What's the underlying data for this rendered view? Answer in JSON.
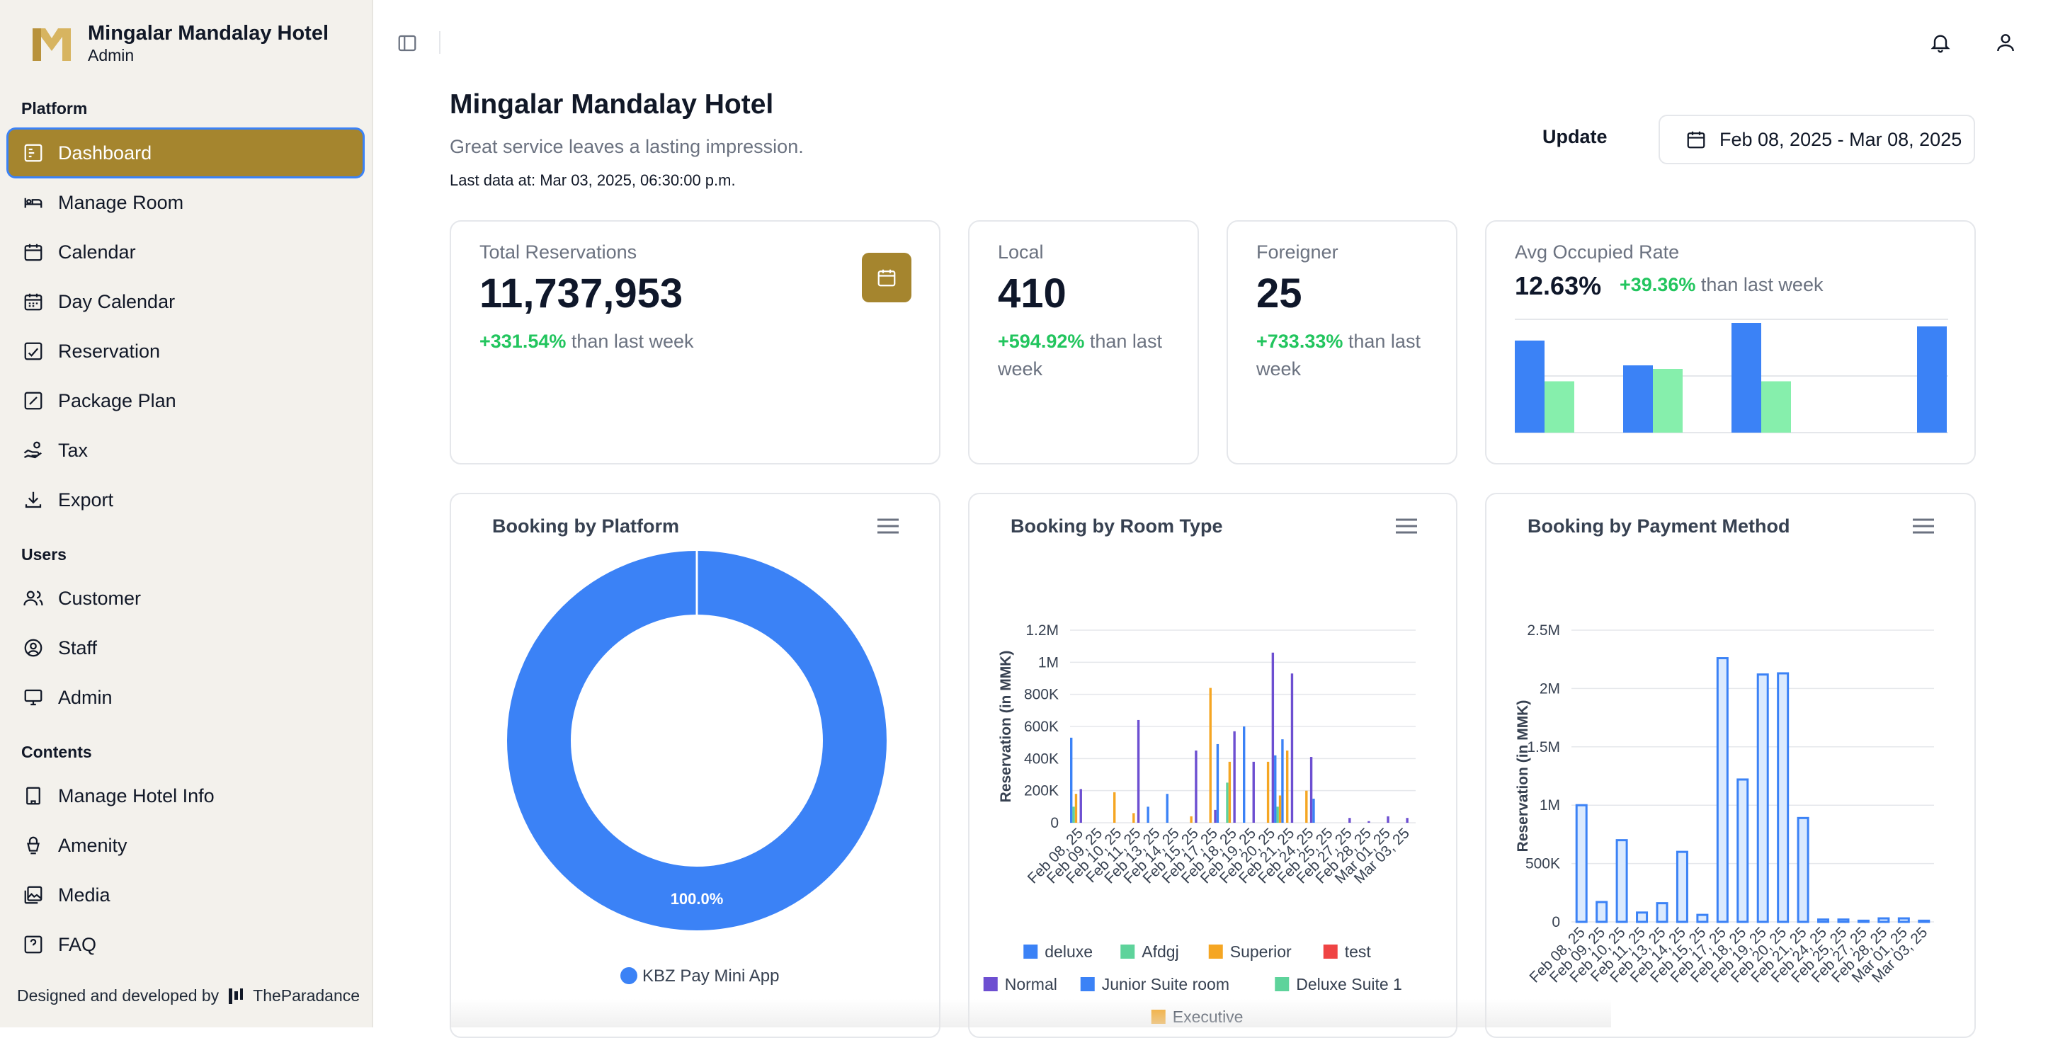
{
  "brand": {
    "name": "Mingalar Mandalay Hotel",
    "role": "Admin"
  },
  "sidebar": {
    "groups": [
      {
        "label": "Platform",
        "items": [
          "Dashboard",
          "Manage Room",
          "Calendar",
          "Day Calendar",
          "Reservation",
          "Package Plan",
          "Tax",
          "Export"
        ]
      },
      {
        "label": "Users",
        "items": [
          "Customer",
          "Staff",
          "Admin"
        ]
      },
      {
        "label": "Contents",
        "items": [
          "Manage Hotel Info",
          "Amenity",
          "Media",
          "FAQ"
        ]
      }
    ],
    "active": "Dashboard",
    "footer_text": "Designed and developed by",
    "footer_brand": "TheParadance"
  },
  "header": {
    "title": "Mingalar Mandalay Hotel",
    "subtitle": "Great service leaves a lasting impression.",
    "last_data": "Last data at: Mar 03, 2025, 06:30:00 p.m.",
    "update_label": "Update",
    "date_range": "Feb 08, 2025 - Mar 08, 2025"
  },
  "kpis": {
    "total": {
      "label": "Total Reservations",
      "value": "11,737,953",
      "delta": "+331.54%",
      "suffix": "than last week"
    },
    "local": {
      "label": "Local",
      "value": "410",
      "delta": "+594.92%",
      "suffix": "than last week"
    },
    "foreigner": {
      "label": "Foreigner",
      "value": "25",
      "delta": "+733.33%",
      "suffix": "than last week"
    },
    "occupied": {
      "label": "Avg Occupied Rate",
      "value": "12.63%",
      "delta": "+39.36%",
      "suffix": "than last week"
    }
  },
  "colors": {
    "accent": "#a5852e",
    "blue": "#3b82f6",
    "green": "#86efac",
    "orange": "#f5a623",
    "red": "#ef4444",
    "purple": "#6d4fd1",
    "teal": "#5ed39b"
  },
  "chart_data": [
    {
      "id": "occupied-mini",
      "type": "bar",
      "series": [
        {
          "values": [
            52,
            38,
            62,
            60
          ]
        },
        {
          "values": [
            29,
            36,
            29,
            0
          ]
        }
      ],
      "grid": true
    },
    {
      "id": "platform",
      "type": "pie",
      "title": "Booking by Platform",
      "labels": [
        "KBZ Pay Mini App"
      ],
      "values": [
        100
      ],
      "data_label": "100.0%"
    },
    {
      "id": "room-type",
      "type": "bar",
      "title": "Booking by Room Type",
      "ylabel": "Reservation (in MMK)",
      "ylim": [
        0,
        1200000
      ],
      "yticks": [
        "0",
        "200K",
        "400K",
        "600K",
        "800K",
        "1M",
        "1.2M"
      ],
      "categories": [
        "Feb 08, 25",
        "Feb 09, 25",
        "Feb 10, 25",
        "Feb 11, 25",
        "Feb 13, 25",
        "Feb 14, 25",
        "Feb 15, 25",
        "Feb 17, 25",
        "Feb 18, 25",
        "Feb 19, 25",
        "Feb 20, 25",
        "Feb 21, 25",
        "Feb 24, 25",
        "Feb 25, 25",
        "Feb 27, 25",
        "Feb 28, 25",
        "Mar 01, 25",
        "Mar 03, 25"
      ],
      "tick_labels": [
        "Feb 08, 25",
        "Feb 09, 25",
        "Feb 10, 25",
        "Feb 11, 25",
        "Feb 13, 25",
        "Feb 14, 25",
        "Feb 15, 25",
        "Feb 17, 25",
        "Feb 18, 25",
        "Feb 19, 25",
        "Feb 20, 25",
        "Feb 21, 25",
        "Feb 24, 25",
        "Feb 25, 25",
        "Feb 27, 25",
        "Feb 28, 25",
        "Mar 01, 25",
        "Mar 03, 25"
      ],
      "series": [
        {
          "name": "deluxe",
          "values": [
            530000,
            0,
            0,
            0,
            100000,
            180000,
            0,
            0,
            0,
            600000,
            0,
            520000,
            0,
            0,
            0,
            0,
            0,
            0
          ]
        },
        {
          "name": "Afdgj",
          "values": [
            100000,
            0,
            0,
            0,
            0,
            0,
            0,
            0,
            250000,
            0,
            0,
            0,
            0,
            0,
            0,
            0,
            0,
            0
          ]
        },
        {
          "name": "Superior",
          "values": [
            180000,
            0,
            190000,
            60000,
            0,
            0,
            40000,
            840000,
            380000,
            0,
            380000,
            450000,
            200000,
            0,
            0,
            0,
            0,
            0
          ]
        },
        {
          "name": "test",
          "values": [
            0,
            0,
            0,
            0,
            0,
            0,
            0,
            0,
            0,
            0,
            0,
            0,
            0,
            0,
            0,
            0,
            0,
            0
          ]
        },
        {
          "name": "Normal",
          "values": [
            210000,
            0,
            0,
            640000,
            0,
            0,
            450000,
            80000,
            570000,
            380000,
            1060000,
            930000,
            410000,
            0,
            30000,
            10000,
            40000,
            30000
          ]
        },
        {
          "name": "Junior Suite room",
          "values": [
            0,
            0,
            0,
            0,
            0,
            0,
            0,
            490000,
            0,
            0,
            420000,
            0,
            150000,
            0,
            0,
            0,
            0,
            0
          ]
        },
        {
          "name": "Deluxe Suite 1",
          "values": [
            0,
            0,
            0,
            0,
            0,
            0,
            0,
            0,
            0,
            0,
            100000,
            0,
            0,
            0,
            0,
            0,
            0,
            0
          ]
        },
        {
          "name": "Executive",
          "values": [
            0,
            0,
            0,
            0,
            0,
            0,
            0,
            0,
            0,
            0,
            170000,
            0,
            0,
            0,
            0,
            0,
            0,
            0
          ]
        }
      ],
      "legend": [
        "deluxe",
        "Afdgj",
        "Superior",
        "test",
        "Normal",
        "Junior Suite room",
        "Deluxe Suite 1",
        "Executive"
      ]
    },
    {
      "id": "payment",
      "type": "bar",
      "title": "Booking by Payment Method",
      "ylabel": "Reservation (in MMK)",
      "ylim": [
        0,
        2500000
      ],
      "yticks": [
        "0",
        "500K",
        "1M",
        "1.5M",
        "2M",
        "2.5M"
      ],
      "categories": [
        "Feb 08, 25",
        "Feb 09, 25",
        "Feb 10, 25",
        "Feb 11, 25",
        "Feb 13, 25",
        "Feb 14, 25",
        "Feb 15, 25",
        "Feb 17, 25",
        "Feb 18, 25",
        "Feb 19, 25",
        "Feb 20, 25",
        "Feb 21, 25",
        "Feb 24, 25",
        "Feb 25, 25",
        "Feb 27, 25",
        "Feb 28, 25",
        "Mar 01, 25",
        "Mar 03, 25"
      ],
      "tick_labels": [
        "Feb 08, 25",
        "Feb 09, 25",
        "Feb 10, 25",
        "Feb 11, 25",
        "Feb 13, 25",
        "Feb 14, 25",
        "Feb 15, 25",
        "Feb 17, 25",
        "Feb 18, 25",
        "Feb 19, 25",
        "Feb 20, 25",
        "Feb 21, 25",
        "Feb 24, 25",
        "Feb 25, 25",
        "Feb 27, 25",
        "Feb 28, 25",
        "Mar 01, 25",
        "Mar 03, 25"
      ],
      "values": [
        1000000,
        170000,
        700000,
        80000,
        160000,
        600000,
        60000,
        2260000,
        1220000,
        2120000,
        2130000,
        890000,
        20000,
        20000,
        10000,
        30000,
        30000,
        10000
      ]
    }
  ]
}
